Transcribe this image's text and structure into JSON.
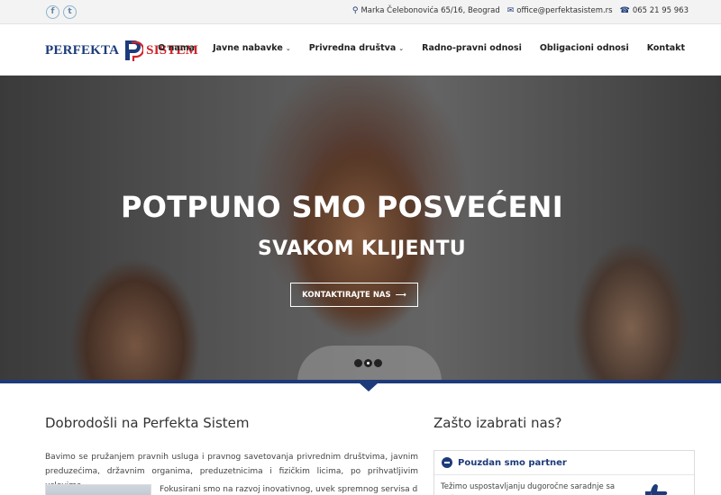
{
  "topbar": {
    "social": [
      {
        "icon": "facebook-icon",
        "glyph": "f"
      },
      {
        "icon": "twitter-icon",
        "glyph": "t"
      }
    ],
    "address": "Marka Čelebonovića 65/16, Beograd",
    "email": "office@perfektasistem.rs",
    "phone": "065 21 95 963"
  },
  "header": {
    "logo_word1": "PERFEKTA",
    "logo_word2": "SISTEM",
    "nav": [
      {
        "label": "O nama",
        "dropdown": false
      },
      {
        "label": "Javne nabavke",
        "dropdown": true
      },
      {
        "label": "Privredna društva",
        "dropdown": true
      },
      {
        "label": "Radno-pravni odnosi",
        "dropdown": false
      },
      {
        "label": "Obligacioni odnosi",
        "dropdown": false
      },
      {
        "label": "Kontakt",
        "dropdown": false
      }
    ]
  },
  "hero": {
    "title": "POTPUNO SMO POSVEĆENI",
    "subtitle": "SVAKOM KLIJENTU",
    "cta_label": "KONTAKTIRAJTE NAS",
    "cta_arrow": "⟶",
    "slides_total": 3,
    "slide_active": 2
  },
  "welcome": {
    "title": "Dobrodošli na Perfekta Sistem",
    "text": "Bavimo se pružanjem pravnih usluga i pravnog savetovanja privrednim društvima, javnim preduzećima, državnim organima, preduzetnicima i fizičkim licima, po prihvatljivim uslovima.",
    "text2": "Fokusirani smo na razvoj inovativnog, uvek spremnog servisa da"
  },
  "why": {
    "title": "Zašto izabrati nas?",
    "accordion_title": "Pouzdan smo partner",
    "accordion_text": "Težimo uspostavljanju dugoročne saradnje sa našim klijentima, po principima međusobnog poverenja i"
  },
  "colors": {
    "brand_blue": "#1d3b7a",
    "brand_red": "#d1232a"
  }
}
